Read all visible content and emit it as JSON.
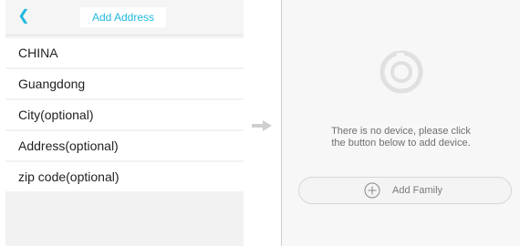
{
  "left_screen": {
    "header": {
      "title": "Add Address",
      "back_icon": "chevron-left-icon",
      "accent": "#20b8de"
    },
    "fields": [
      {
        "value": "CHINA"
      },
      {
        "value": "Guangdong"
      },
      {
        "value": "City(optional)"
      },
      {
        "value": "Address(optional)"
      },
      {
        "value": "zip code(optional)"
      }
    ]
  },
  "transition": {
    "icon": "arrow-right-icon"
  },
  "right_screen": {
    "empty_state": {
      "icon": "empty-devices-ring-icon",
      "message_line1": "There is no device, please click",
      "message_line2": "the button below to add device."
    },
    "add_family_button": {
      "icon": "plus-circle-icon",
      "label": "Add Family"
    }
  }
}
